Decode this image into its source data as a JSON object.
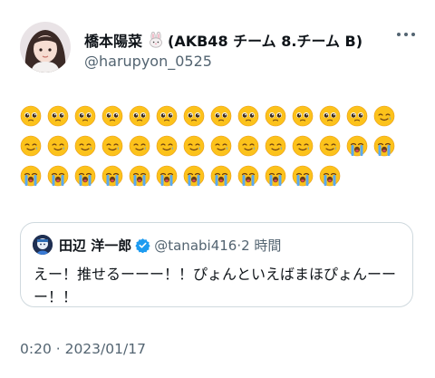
{
  "tweet": {
    "display_name": "橋本陽菜",
    "name_suffix": "(AKB48 チーム 8.チーム B)",
    "handle": "@harupyon_0525",
    "emoji_text": {
      "row1": "🥹🥹🥹🥹🥹🥹🥹🥹🥹🥹🥹🥹🥹🥲",
      "row2": "🥲🥲🥲🥲🥲🥲🥲🥲🥲🥲🥲🥲😭😭",
      "row3": "😭😭😭😭😭😭😭😭😭😭😭😭"
    },
    "timestamp": "0:20 · 2023/01/17"
  },
  "quote": {
    "name": "田辺 洋一郎",
    "handle": "@tanabi416",
    "separator": "·",
    "time": "2 時間",
    "text": "えー！推せるーーー！！ぴょんといえばまほぴょんーーー！！"
  },
  "icons": [
    "rabbit-emoji-icon",
    "more-options-icon",
    "verified-badge-icon"
  ],
  "colors": {
    "secondary_text": "#536471",
    "verified": "#1d9bf0",
    "border": "#cfd9de"
  }
}
